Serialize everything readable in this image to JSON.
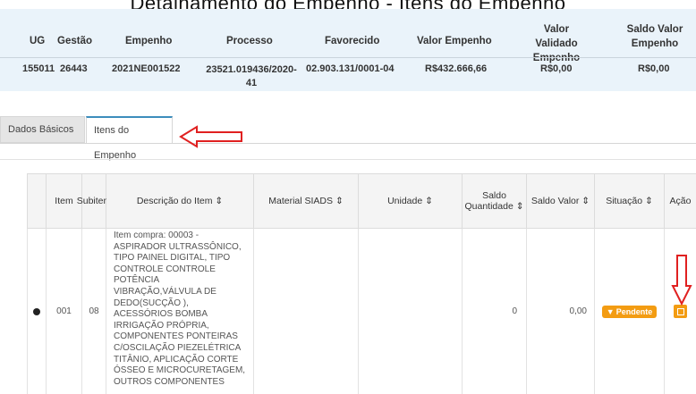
{
  "page_title": "Detalhamento do Empenho - Itens do Empenho",
  "header": {
    "columns": [
      "UG",
      "Gestão",
      "Empenho",
      "Processo",
      "Favorecido",
      "Valor Empenho",
      "Valor Validado Empenho",
      "Saldo Valor Empenho"
    ],
    "row": {
      "ug": "155011",
      "gestao": "26443",
      "empenho": "2021NE001522",
      "processo": "23521.019436/2020-41",
      "favorecido": "02.903.131/0001-04",
      "valor_empenho": "R$432.666,66",
      "valor_validado": "R$0,00",
      "saldo_valor": "R$0,00"
    }
  },
  "tabs": [
    {
      "label": "Dados Básicos",
      "active": false
    },
    {
      "label": "Itens do Empenho",
      "active": true
    }
  ],
  "items_table": {
    "columns": [
      "Item",
      "Subitem",
      "Descrição do Item ⇕",
      "Material SIADS ⇕",
      "Unidade ⇕",
      "Saldo Quantidade ⇕",
      "Saldo Valor ⇕",
      "Situação ⇕",
      "Ação"
    ],
    "rows": [
      {
        "item": "001",
        "subitem": "08",
        "descricao": "Item compra: 00003 - ASPIRADOR ULTRASSÔNICO, TIPO PAINEL DIGITAL, TIPO CONTROLE CONTROLE POTÊNCIA VIBRAÇÃO,VÁLVULA DE DEDO(SUCÇÃO ), ACESSÓRIOS BOMBA IRRIGAÇÃO PRÓPRIA, COMPONENTES PONTEIRAS C/OSCILAÇÃO PIEZELÉTRICA TITÂNIO, APLICAÇÃO CORTE ÓSSEO E MICROCURETAGEM, OUTROS COMPONENTES",
        "material_siads": "",
        "unidade": "",
        "saldo_quantidade": "0",
        "saldo_valor": "0,00",
        "situacao": "Pendente"
      }
    ]
  },
  "colors": {
    "accent": "#f39c12",
    "header_bg": "#eaf3fa",
    "arrow": "#e02020",
    "tab_active": "#3c8dbc"
  }
}
